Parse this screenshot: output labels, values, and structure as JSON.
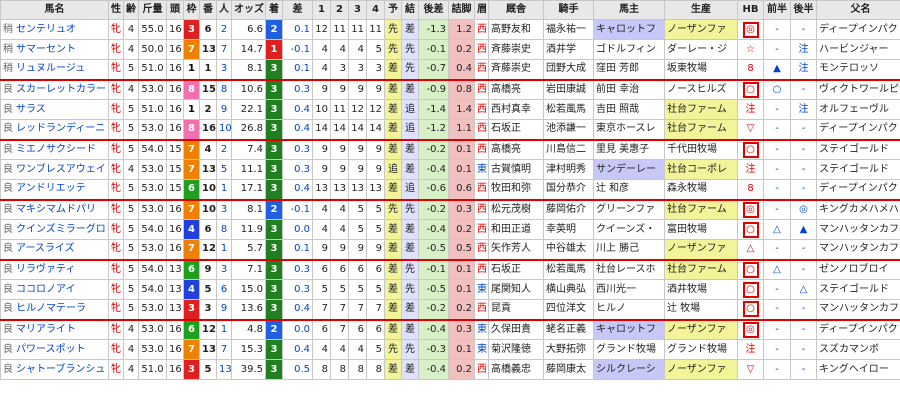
{
  "headers": [
    "馬名",
    "性",
    "齢",
    "斤量",
    "頭",
    "枠",
    "番",
    "人",
    "オッズ",
    "着",
    "差",
    "1",
    "2",
    "3",
    "4",
    "予",
    "結",
    "後差",
    "詰脚",
    "眉",
    "厩舎",
    "騎手",
    "馬主",
    "生産",
    "HB",
    "前半",
    "後半",
    "父名",
    "開脚"
  ],
  "rows": [
    {
      "cond": "稍",
      "name": "センテリュオ",
      "sex": "牝",
      "age": "4",
      "kin": "55.0",
      "tou": "16",
      "waku": "3",
      "ban": "6",
      "nin": "2",
      "odds": "6.6",
      "chaku": "2",
      "sa": "0.1",
      "c1": "12",
      "c2": "11",
      "c3": "11",
      "c4": "11",
      "yo": "先",
      "ketsu": "差",
      "kosa": "-1.3",
      "tsume": "1.2",
      "mayu": "西",
      "kyusha": "高野友和",
      "kishu": "福永祐一",
      "banushi": "キャロットフ",
      "seisan": "ノーザンファ",
      "hb": "◎",
      "zen": "-",
      "kou": "-",
      "chichi": "ディープインパクト",
      "kai": "13"
    },
    {
      "cond": "稍",
      "name": "サマーセント",
      "sex": "牝",
      "age": "4",
      "kin": "50.0",
      "tou": "16",
      "waku": "7",
      "ban": "13",
      "nin": "7",
      "odds": "14.7",
      "chaku": "1",
      "sa": "-0.1",
      "c1": "4",
      "c2": "4",
      "c3": "4",
      "c4": "5",
      "yo": "先",
      "ketsu": "先",
      "kosa": "-0.1",
      "tsume": "0.2",
      "mayu": "西",
      "kyusha": "斉藤崇史",
      "kishu": "酒井学",
      "banushi": "ゴドルフィン",
      "seisan": "ダーレー・ジ",
      "hb": "☆",
      "zen": "-",
      "kou": "注",
      "chichi": "ハービンジャー",
      "kai": "5"
    },
    {
      "cond": "稍",
      "name": "リュヌルージュ",
      "sex": "牝",
      "age": "5",
      "kin": "51.0",
      "tou": "16",
      "waku": "1",
      "ban": "1",
      "nin": "3",
      "odds": "8.1",
      "chaku": "3",
      "sa": "0.1",
      "c1": "4",
      "c2": "3",
      "c3": "3",
      "c4": "3",
      "yo": "差",
      "ketsu": "先",
      "kosa": "-0.7",
      "tsume": "0.4",
      "mayu": "西",
      "kyusha": "斉藤崇史",
      "kishu": "団野大成",
      "banushi": "窪田 芳郎",
      "seisan": "坂東牧場",
      "hb": "8",
      "zen": "▲",
      "kou": "注",
      "chichi": "モンテロッソ",
      "kai": "6"
    },
    {
      "cond": "良",
      "name": "スカーレットカラー",
      "sex": "牝",
      "age": "4",
      "kin": "53.0",
      "tou": "16",
      "waku": "8",
      "ban": "15",
      "nin": "8",
      "odds": "10.6",
      "chaku": "3",
      "sa": "0.3",
      "c1": "9",
      "c2": "9",
      "c3": "9",
      "c4": "9",
      "yo": "差",
      "ketsu": "差",
      "kosa": "-0.9",
      "tsume": "0.8",
      "mayu": "西",
      "kyusha": "高橋亮",
      "kishu": "岩田康誠",
      "banushi": "前田 幸治",
      "seisan": "ノースヒルズ",
      "hb": "○",
      "zen": "○",
      "kou": "-",
      "chichi": "ヴィクトワールピサ",
      "kai": "4"
    },
    {
      "cond": "良",
      "name": "サラス",
      "sex": "牝",
      "age": "5",
      "kin": "51.0",
      "tou": "16",
      "waku": "1",
      "ban": "2",
      "nin": "9",
      "odds": "22.1",
      "chaku": "3",
      "sa": "0.4",
      "c1": "10",
      "c2": "11",
      "c3": "12",
      "c4": "12",
      "yo": "差",
      "ketsu": "追",
      "kosa": "-1.4",
      "tsume": "1.4",
      "mayu": "西",
      "kyusha": "西村真幸",
      "kishu": "松若風馬",
      "banushi": "吉田 照哉",
      "seisan": "社台ファーム",
      "hb": "注",
      "zen": "-",
      "kou": "注",
      "chichi": "オルフェーヴル",
      "kai": "3"
    },
    {
      "cond": "良",
      "name": "レッドランディーニ",
      "sex": "牝",
      "age": "5",
      "kin": "53.0",
      "tou": "16",
      "waku": "8",
      "ban": "16",
      "nin": "10",
      "odds": "26.8",
      "chaku": "3",
      "sa": "0.4",
      "c1": "14",
      "c2": "14",
      "c3": "14",
      "c4": "14",
      "yo": "差",
      "ketsu": "追",
      "kosa": "-1.2",
      "tsume": "1.1",
      "mayu": "西",
      "kyusha": "石坂正",
      "kishu": "池添謙一",
      "banushi": "東京ホースレ",
      "seisan": "社台ファーム",
      "hb": "▽",
      "zen": "-",
      "kou": "-",
      "chichi": "ディープインパクト",
      "kai": "5"
    },
    {
      "cond": "良",
      "name": "ミエノサクシード",
      "sex": "牝",
      "age": "5",
      "kin": "54.0",
      "tou": "15",
      "waku": "7",
      "ban": "4",
      "nin": "2",
      "odds": "7.4",
      "chaku": "3",
      "sa": "0.3",
      "c1": "9",
      "c2": "9",
      "c3": "9",
      "c4": "9",
      "yo": "差",
      "ketsu": "差",
      "kosa": "-0.2",
      "tsume": "0.1",
      "mayu": "西",
      "kyusha": "高橋亮",
      "kishu": "川島信二",
      "banushi": "里見 美惠子",
      "seisan": "千代田牧場",
      "hb": "○",
      "zen": "-",
      "kou": "-",
      "chichi": "ステイゴールド",
      "kai": "6"
    },
    {
      "cond": "良",
      "name": "ワンブレスアウェイ",
      "sex": "牝",
      "age": "4",
      "kin": "53.0",
      "tou": "15",
      "waku": "7",
      "ban": "13",
      "nin": "5",
      "odds": "11.1",
      "chaku": "3",
      "sa": "0.3",
      "c1": "9",
      "c2": "9",
      "c3": "9",
      "c4": "9",
      "yo": "追",
      "ketsu": "差",
      "kosa": "-0.4",
      "tsume": "0.1",
      "mayu": "東",
      "kyusha": "古賀慎明",
      "kishu": "津村明秀",
      "banushi": "サンデーレー",
      "seisan": "社台コーポレ",
      "hb": "注",
      "zen": "-",
      "kou": "-",
      "chichi": "ステイゴールド",
      "kai": "4"
    },
    {
      "cond": "良",
      "name": "アンドリエッテ",
      "sex": "牝",
      "age": "5",
      "kin": "53.0",
      "tou": "15",
      "waku": "6",
      "ban": "10",
      "nin": "1",
      "odds": "17.1",
      "chaku": "3",
      "sa": "0.4",
      "c1": "13",
      "c2": "13",
      "c3": "13",
      "c4": "13",
      "yo": "差",
      "ketsu": "追",
      "kosa": "-0.6",
      "tsume": "0.6",
      "mayu": "西",
      "kyusha": "牧田和弥",
      "kishu": "国分恭介",
      "banushi": "辻 和彦",
      "seisan": "森永牧場",
      "hb": "8",
      "zen": "-",
      "kou": "-",
      "chichi": "ディープインパクト",
      "kai": "6"
    },
    {
      "cond": "良",
      "name": "マキシマムドパリ",
      "sex": "牝",
      "age": "5",
      "kin": "53.0",
      "tou": "16",
      "waku": "7",
      "ban": "10",
      "nin": "3",
      "odds": "8.1",
      "chaku": "2",
      "sa": "-0.1",
      "c1": "4",
      "c2": "4",
      "c3": "5",
      "c4": "5",
      "yo": "先",
      "ketsu": "先",
      "kosa": "-0.2",
      "tsume": "0.3",
      "mayu": "西",
      "kyusha": "松元茂樹",
      "kishu": "藤岡佑介",
      "banushi": "グリーンファ",
      "seisan": "社台ファーム",
      "hb": "◎",
      "zen": "-",
      "kou": "◎",
      "chichi": "キングカメハメハ",
      "kai": "13"
    },
    {
      "cond": "良",
      "name": "クインズミラーグロ",
      "sex": "牝",
      "age": "5",
      "kin": "54.0",
      "tou": "16",
      "waku": "4",
      "ban": "6",
      "nin": "8",
      "odds": "11.9",
      "chaku": "3",
      "sa": "0.0",
      "c1": "4",
      "c2": "4",
      "c3": "5",
      "c4": "5",
      "yo": "差",
      "ketsu": "差",
      "kosa": "-0.4",
      "tsume": "0.2",
      "mayu": "西",
      "kyusha": "和田正道",
      "kishu": "幸英明",
      "banushi": "クイーンズ・",
      "seisan": "富田牧場",
      "hb": "○",
      "zen": "△",
      "kou": "▲",
      "chichi": "マンハッタンカフェ",
      "kai": "6"
    },
    {
      "cond": "良",
      "name": "アースライズ",
      "sex": "牝",
      "age": "5",
      "kin": "53.0",
      "tou": "16",
      "waku": "7",
      "ban": "12",
      "nin": "1",
      "odds": "5.7",
      "chaku": "3",
      "sa": "0.1",
      "c1": "9",
      "c2": "9",
      "c3": "9",
      "c4": "9",
      "yo": "差",
      "ketsu": "差",
      "kosa": "-0.5",
      "tsume": "0.5",
      "mayu": "西",
      "kyusha": "矢作芳人",
      "kishu": "中谷雄太",
      "banushi": "川上 勝己",
      "seisan": "ノーザンファ",
      "hb": "△",
      "zen": "-",
      "kou": "-",
      "chichi": "マンハッタンカフェ",
      "kai": "5"
    },
    {
      "cond": "良",
      "name": "リラヴァティ",
      "sex": "牝",
      "age": "5",
      "kin": "54.0",
      "tou": "13",
      "waku": "6",
      "ban": "9",
      "nin": "3",
      "odds": "7.1",
      "chaku": "3",
      "sa": "0.3",
      "c1": "6",
      "c2": "6",
      "c3": "6",
      "c4": "6",
      "yo": "差",
      "ketsu": "先",
      "kosa": "-0.1",
      "tsume": "0.1",
      "mayu": "西",
      "kyusha": "石坂正",
      "kishu": "松若風馬",
      "banushi": "社台レースホ",
      "seisan": "社台ファーム",
      "hb": "○",
      "zen": "△",
      "kou": "-",
      "chichi": "ゼンノロブロイ",
      "kai": "5"
    },
    {
      "cond": "良",
      "name": "ココロノアイ",
      "sex": "牝",
      "age": "5",
      "kin": "54.0",
      "tou": "13",
      "waku": "4",
      "ban": "5",
      "nin": "6",
      "odds": "15.0",
      "chaku": "3",
      "sa": "0.3",
      "c1": "5",
      "c2": "5",
      "c3": "5",
      "c4": "5",
      "yo": "差",
      "ketsu": "先",
      "kosa": "-0.5",
      "tsume": "0.1",
      "mayu": "東",
      "kyusha": "尾関知人",
      "kishu": "横山典弘",
      "banushi": "西川光一",
      "seisan": "酒井牧場",
      "hb": "○",
      "zen": "-",
      "kou": "△",
      "chichi": "ステイゴールド",
      "kai": "5"
    },
    {
      "cond": "良",
      "name": "ヒルノマテーラ",
      "sex": "牝",
      "age": "5",
      "kin": "53.0",
      "tou": "13",
      "waku": "3",
      "ban": "3",
      "nin": "9",
      "odds": "13.6",
      "chaku": "3",
      "sa": "0.4",
      "c1": "7",
      "c2": "7",
      "c3": "7",
      "c4": "7",
      "yo": "差",
      "ketsu": "差",
      "kosa": "-0.2",
      "tsume": "0.2",
      "mayu": "西",
      "kyusha": "昆貢",
      "kishu": "四位洋文",
      "banushi": "ヒルノ",
      "seisan": "辻 牧場",
      "hb": "○",
      "zen": "-",
      "kou": "-",
      "chichi": "マンハッタンカフェ",
      "kai": "6"
    },
    {
      "cond": "良",
      "name": "マリアライト",
      "sex": "牝",
      "age": "4",
      "kin": "53.0",
      "tou": "16",
      "waku": "6",
      "ban": "12",
      "nin": "1",
      "odds": "4.8",
      "chaku": "2",
      "sa": "0.0",
      "c1": "6",
      "c2": "7",
      "c3": "6",
      "c4": "6",
      "yo": "差",
      "ketsu": "差",
      "kosa": "-0.4",
      "tsume": "0.3",
      "mayu": "東",
      "kyusha": "久保田貴",
      "kishu": "蛯名正義",
      "banushi": "キャロットフ",
      "seisan": "ノーザンファ",
      "hb": "◎",
      "zen": "-",
      "kou": "-",
      "chichi": "ディープインパクト",
      "kai": "6"
    },
    {
      "cond": "良",
      "name": "パワースポット",
      "sex": "牝",
      "age": "4",
      "kin": "53.0",
      "tou": "16",
      "waku": "7",
      "ban": "13",
      "nin": "7",
      "odds": "15.3",
      "chaku": "3",
      "sa": "0.4",
      "c1": "4",
      "c2": "4",
      "c3": "4",
      "c4": "5",
      "yo": "先",
      "ketsu": "先",
      "kosa": "-0.3",
      "tsume": "0.1",
      "mayu": "東",
      "kyusha": "菊沢隆徳",
      "kishu": "大野拓弥",
      "banushi": "グランド牧場",
      "seisan": "グランド牧場",
      "hb": "注",
      "zen": "-",
      "kou": "-",
      "chichi": "スズカマンボ",
      "kai": "5"
    },
    {
      "cond": "良",
      "name": "シャトーブランシュ",
      "sex": "牝",
      "age": "4",
      "kin": "51.0",
      "tou": "16",
      "waku": "3",
      "ban": "5",
      "nin": "13",
      "odds": "39.5",
      "chaku": "3",
      "sa": "0.5",
      "c1": "8",
      "c2": "8",
      "c3": "8",
      "c4": "8",
      "yo": "差",
      "ketsu": "差",
      "kosa": "-0.4",
      "tsume": "0.2",
      "mayu": "西",
      "kyusha": "高橋義忠",
      "kishu": "藤岡康太",
      "banushi": "シルクレーシ",
      "seisan": "ノーザンファ",
      "hb": "▽",
      "zen": "-",
      "kou": "-",
      "chichi": "キングヘイロー",
      "kai": "6"
    }
  ],
  "colors": {
    "waku": {
      "1": "#ffffff",
      "2": "#222222",
      "3": "#e02020",
      "4": "#2040e0",
      "5": "#f0d000",
      "6": "#20a020",
      "7": "#f08000",
      "8": "#f070b0"
    },
    "chaku": {
      "1": "#e02020",
      "2": "#2060e0",
      "3": "#208020"
    }
  }
}
